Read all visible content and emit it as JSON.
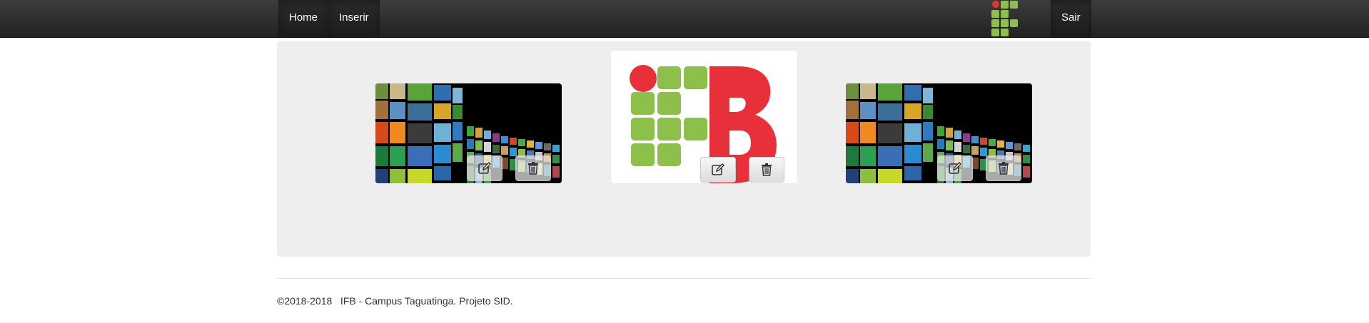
{
  "navbar": {
    "home_label": "Home",
    "insert_label": "Inserir",
    "logout_label": "Sair",
    "bg_color": "#222222"
  },
  "gallery": {
    "items": [
      {
        "image": "video-wall-image",
        "edit_icon": "edit-icon",
        "delete_icon": "trash-icon"
      },
      {
        "image": "ifb-logo-image",
        "edit_icon": "edit-icon",
        "delete_icon": "trash-icon"
      },
      {
        "image": "video-wall-image",
        "edit_icon": "edit-icon",
        "delete_icon": "trash-icon"
      }
    ]
  },
  "footer": {
    "text": "©2018-2018   IFB - Campus Taguatinga. Projeto SID."
  },
  "colors": {
    "ifb_green": "#8cc04a",
    "ifb_red": "#e8303a",
    "panel_bg": "#eeeeee"
  }
}
